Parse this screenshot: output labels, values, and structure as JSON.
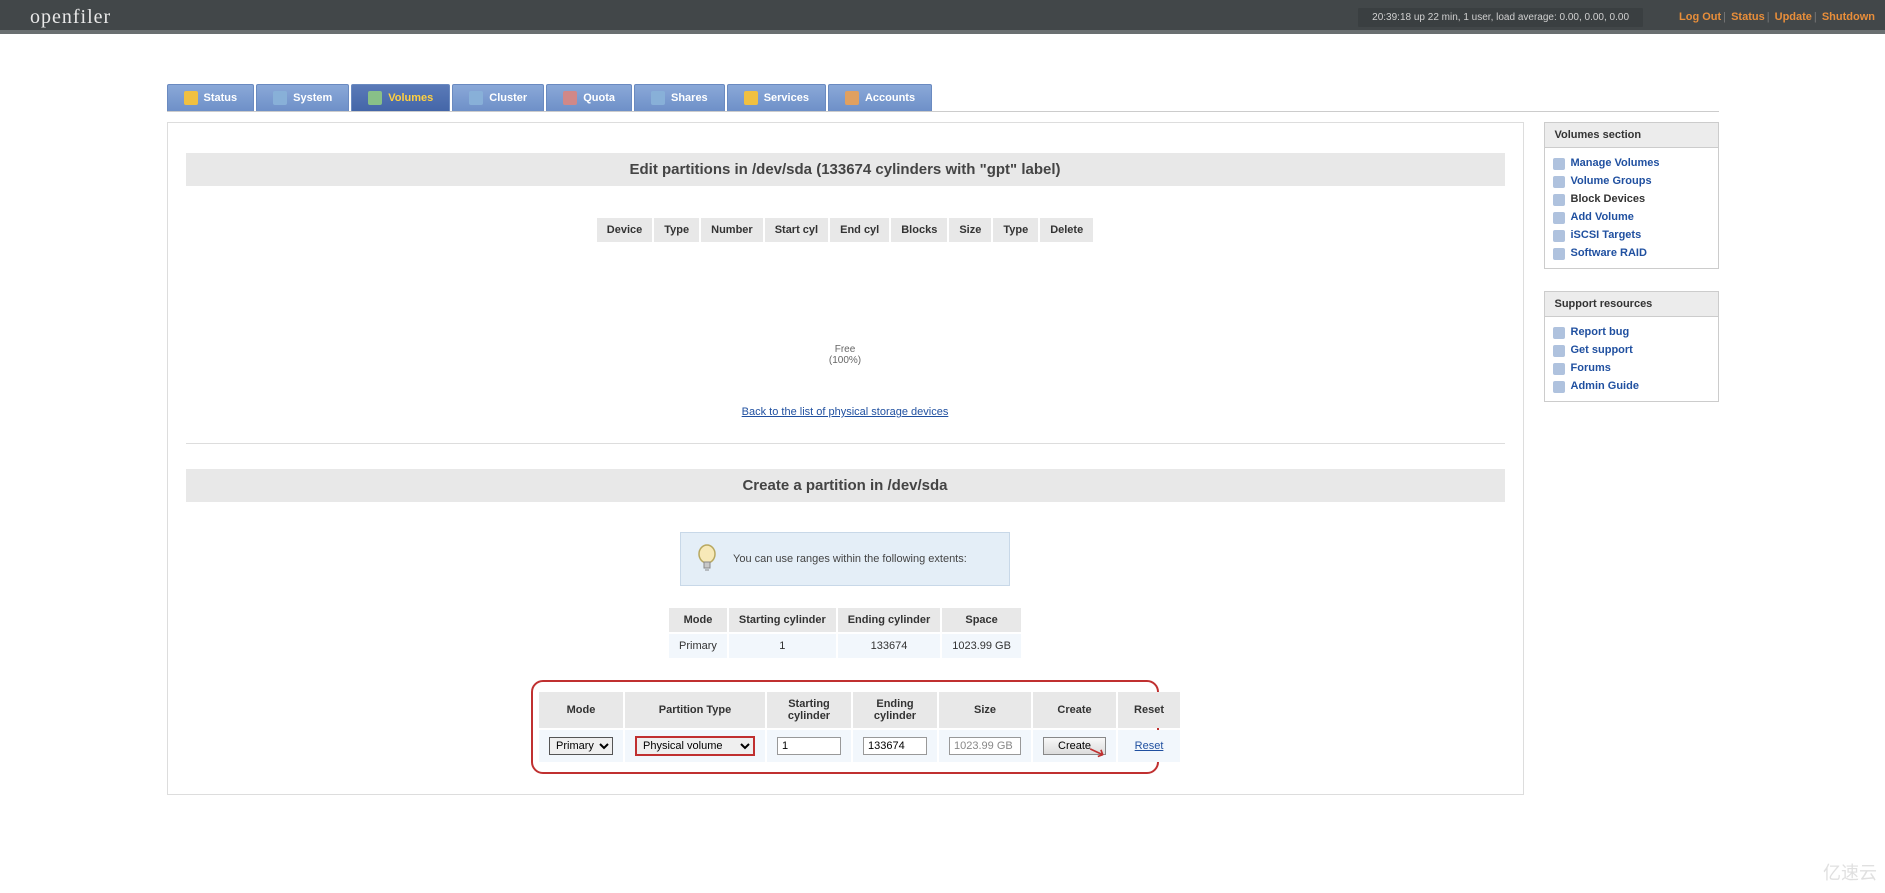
{
  "header": {
    "brand": "openfiler",
    "uptime": "20:39:18 up 22 min, 1 user, load average: 0.00, 0.00, 0.00",
    "links": {
      "logout": "Log Out",
      "status": "Status",
      "update": "Update",
      "shutdown": "Shutdown"
    }
  },
  "tabs": [
    {
      "label": "Status",
      "icon": "home-icon"
    },
    {
      "label": "System",
      "icon": "system-icon"
    },
    {
      "label": "Volumes",
      "icon": "volumes-icon",
      "active": true
    },
    {
      "label": "Cluster",
      "icon": "cluster-icon"
    },
    {
      "label": "Quota",
      "icon": "quota-icon"
    },
    {
      "label": "Shares",
      "icon": "shares-icon"
    },
    {
      "label": "Services",
      "icon": "services-icon"
    },
    {
      "label": "Accounts",
      "icon": "accounts-icon"
    }
  ],
  "sidebar": {
    "volumes": {
      "title": "Volumes section",
      "items": [
        "Manage Volumes",
        "Volume Groups",
        "Block Devices",
        "Add Volume",
        "iSCSI Targets",
        "Software RAID"
      ],
      "current_index": 2
    },
    "support": {
      "title": "Support resources",
      "items": [
        "Report bug",
        "Get support",
        "Forums",
        "Admin Guide"
      ]
    }
  },
  "edit": {
    "title": "Edit partitions in /dev/sda (133674 cylinders with \"gpt\" label)",
    "columns": [
      "Device",
      "Type",
      "Number",
      "Start cyl",
      "End cyl",
      "Blocks",
      "Size",
      "Type",
      "Delete"
    ],
    "free_label": "Free",
    "free_pct": "(100%)",
    "back_link": "Back to the list of physical storage devices"
  },
  "create": {
    "title": "Create a partition in /dev/sda",
    "hint": "You can use ranges within the following extents:",
    "extent_headers": [
      "Mode",
      "Starting cylinder",
      "Ending cylinder",
      "Space"
    ],
    "extent_row": {
      "mode": "Primary",
      "start": "1",
      "end": "133674",
      "space": "1023.99 GB"
    },
    "form_headers": [
      "Mode",
      "Partition Type",
      "Starting cylinder",
      "Ending cylinder",
      "Size",
      "Create",
      "Reset"
    ],
    "mode_value": "Primary",
    "ptype_value": "Physical volume",
    "start_value": "1",
    "end_value": "133674",
    "size_value": "1023.99 GB",
    "create_btn": "Create",
    "reset_link": "Reset"
  },
  "watermark": "亿速云"
}
